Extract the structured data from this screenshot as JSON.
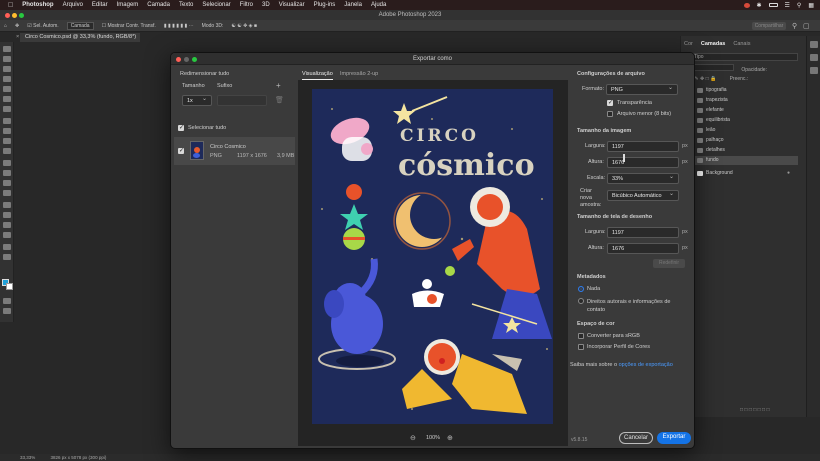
{
  "menubar": {
    "apple": "",
    "items": [
      "Photoshop",
      "Arquivo",
      "Editar",
      "Imagem",
      "Camada",
      "Texto",
      "Selecionar",
      "Filtro",
      "3D",
      "Visualizar",
      "Plug-ins",
      "Janela",
      "Ajuda"
    ],
    "clock": "",
    "status_icons": [
      "screen-mirror-icon",
      "bluetooth-icon",
      "battery-icon",
      "wifi-icon",
      "search-icon",
      "control-center-icon"
    ]
  },
  "window": {
    "title": "Adobe Photoshop 2023"
  },
  "options_bar": {
    "auto_select_label": "Sel. Autom.",
    "layer_select": "Camada",
    "show_transform": "Mostrar Contr. Transf.",
    "mode_3d": "Modo 3D:",
    "share_label": "Compartilhar"
  },
  "document_tab": {
    "label": "Circo Cosmico.psd @ 33,3% (fundo, RGB/8*)"
  },
  "right_panel": {
    "tabs": [
      "Cor",
      "Camadas",
      "Canais"
    ],
    "active_tab": "Camadas",
    "search_placeholder": "Tipo",
    "opacity_label": "Opacidade:",
    "fill_label": "Preenc.:",
    "layers": [
      "tipografia",
      "trapezista",
      "elefante",
      "equilibrista",
      "leão",
      "palhaço",
      "detalhes",
      "fundo",
      "Background"
    ]
  },
  "status_bar": {
    "zoom": "33,33%",
    "dimensions": "3826 px x 5078 px (300 ppi)"
  },
  "dialog": {
    "title": "Exportar como",
    "resize_all": {
      "title": "Redimensionar tudo",
      "size_label": "Tamanho",
      "suffix_label": "Sufixo",
      "size_value": "1x",
      "suffix_value": ""
    },
    "select_all": "Selecionar tudo",
    "asset": {
      "name": "Circo Cosmico",
      "format": "PNG",
      "dimensions": "1197 x 1676",
      "filesize": "3,9 MB"
    },
    "preview_tabs": [
      "Visualização",
      "Impressão 2-up"
    ],
    "active_preview_tab": "Visualização",
    "zoom_value": "100%",
    "file_settings": {
      "title": "Configurações de arquivo",
      "format_label": "Formato:",
      "format_value": "PNG",
      "transparency": "Transparência",
      "smaller_file": "Arquivo menor (8 bits)"
    },
    "image_size": {
      "title": "Tamanho da imagem",
      "width_label": "Largura:",
      "width_value": "1197",
      "height_label": "Altura:",
      "height_value": "1676",
      "scale_label": "Escala:",
      "scale_value": "33%",
      "resample_label": "Criar nova amostra:",
      "resample_value": "Bicúbico Automático",
      "unit": "px"
    },
    "canvas_size": {
      "title": "Tamanho de tela de desenho",
      "width_label": "Largura:",
      "width_value": "1197",
      "height_label": "Altura:",
      "height_value": "1676",
      "reset_label": "Redefinir",
      "unit": "px"
    },
    "metadata": {
      "title": "Metadados",
      "none": "Nada",
      "copyright": "Direitos autorais e informações de contato"
    },
    "color_space": {
      "title": "Espaço de cor",
      "convert": "Converter para sRGB",
      "embed": "Incorporar Perfil de Cores"
    },
    "learn_more_prefix": "Saiba mais sobre o",
    "learn_more_link": "opções de exportação",
    "version": "v5.8.15",
    "cancel": "Cancelar",
    "export": "Exportar",
    "artwork": {
      "line1": "CIRCO",
      "line2": "cósmico"
    }
  },
  "colors": {
    "accent": "#1473e6",
    "artwork_bg": "#1e2a5a"
  }
}
